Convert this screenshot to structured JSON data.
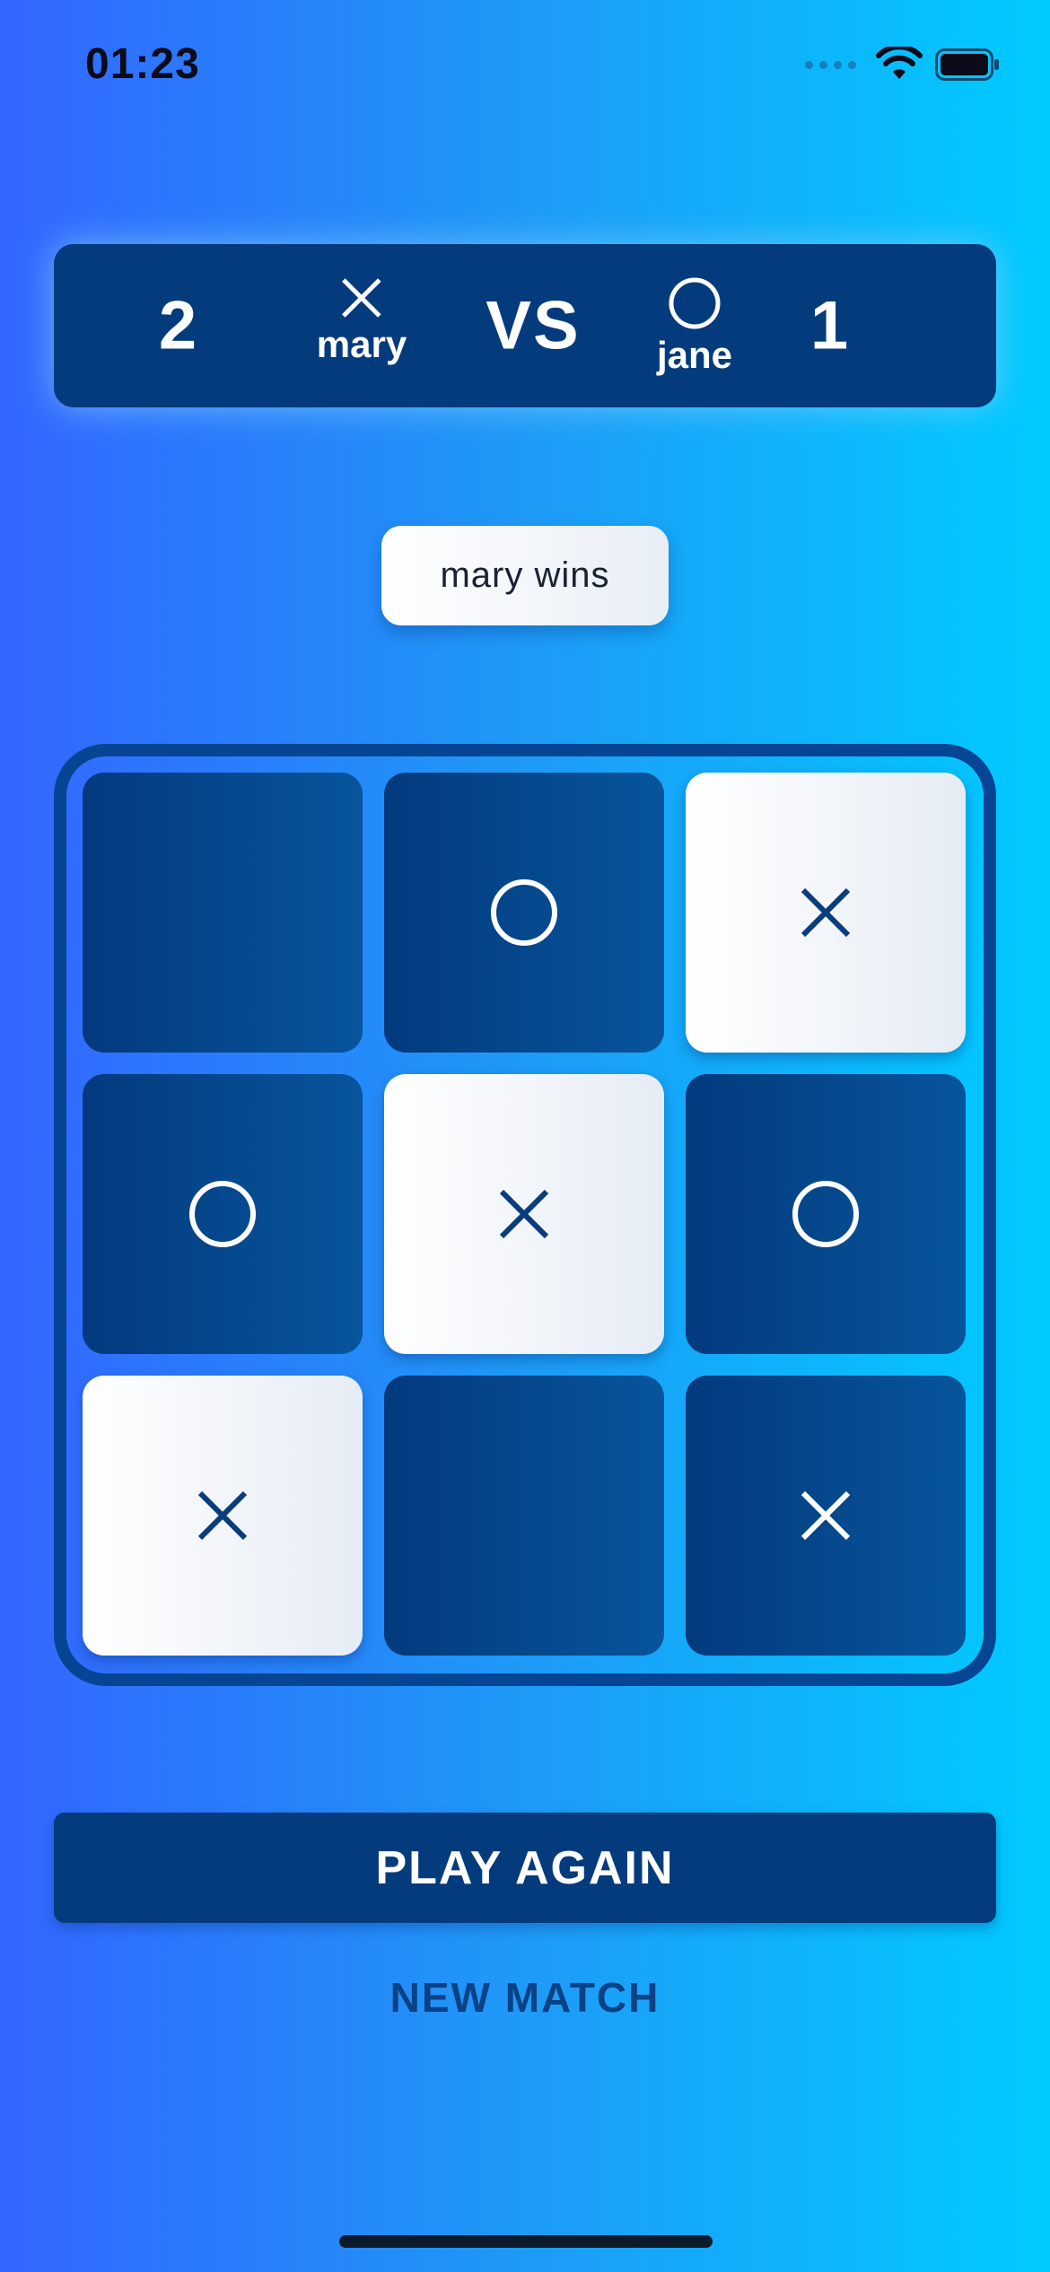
{
  "status_bar": {
    "time": "01:23",
    "icons": [
      "cellular-dots-icon",
      "wifi-icon",
      "battery-icon"
    ]
  },
  "scoreboard": {
    "left_score": "2",
    "right_score": "1",
    "vs_label": "VS",
    "left_player": {
      "name": "mary",
      "mark": "x-icon"
    },
    "right_player": {
      "name": "jane",
      "mark": "o-icon"
    }
  },
  "result": {
    "text": "mary wins"
  },
  "board": {
    "cells": [
      {
        "mark": "",
        "winning": false
      },
      {
        "mark": "O",
        "winning": false
      },
      {
        "mark": "X",
        "winning": true
      },
      {
        "mark": "O",
        "winning": false
      },
      {
        "mark": "X",
        "winning": true
      },
      {
        "mark": "O",
        "winning": false
      },
      {
        "mark": "X",
        "winning": true
      },
      {
        "mark": "",
        "winning": false
      },
      {
        "mark": "X",
        "winning": false
      }
    ]
  },
  "actions": {
    "play_again_label": "PLAY AGAIN",
    "new_match_label": "NEW MATCH"
  },
  "colors": {
    "background_start": "#3366ff",
    "background_end": "#00cbff",
    "dark_blue": "#043b7d",
    "win_tile": "#ffffff",
    "mark_on_dark": "#ffffff",
    "mark_on_light": "#0a3d7f",
    "new_match_text": "#0b4185"
  }
}
